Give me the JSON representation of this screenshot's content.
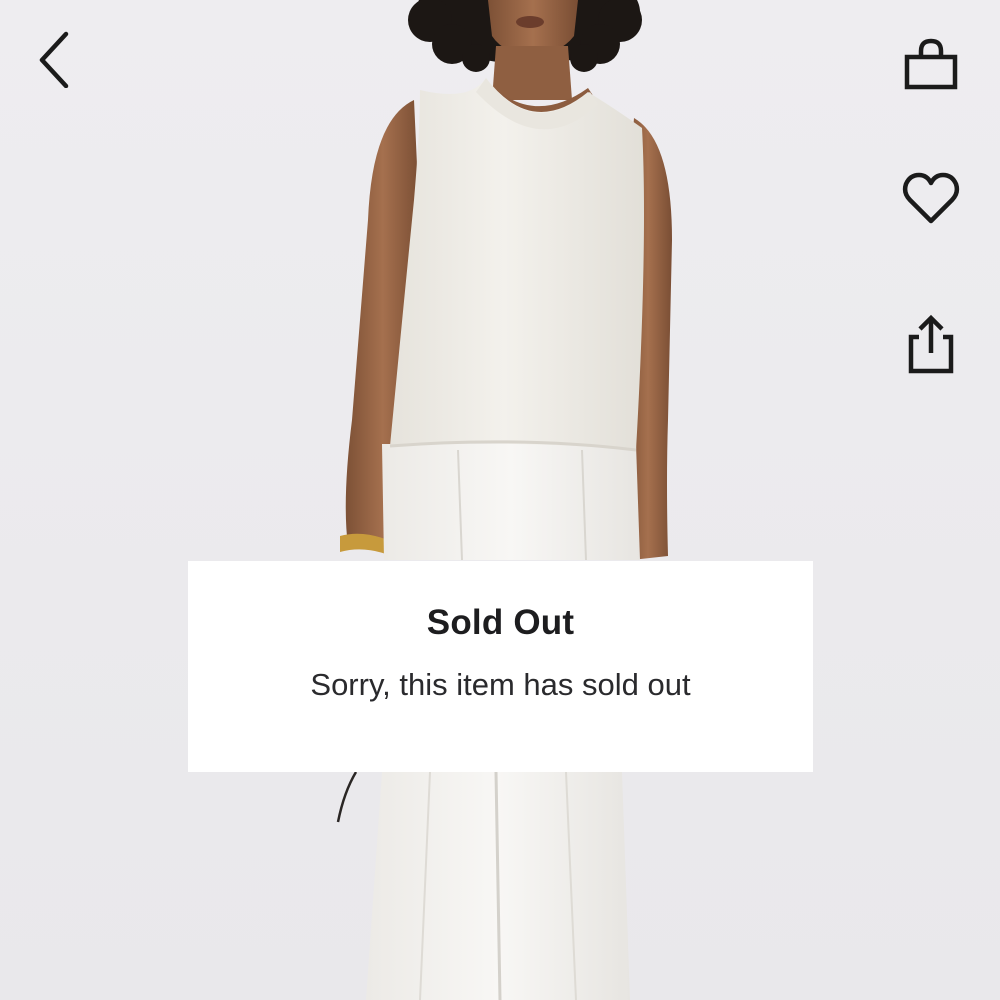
{
  "navigation": {
    "back_icon": "chevron-left-icon"
  },
  "actions": {
    "items": [
      {
        "icon": "shopping-bag-icon"
      },
      {
        "icon": "heart-icon"
      },
      {
        "icon": "share-icon"
      }
    ]
  },
  "product_image": {
    "description_colors": {
      "background": "#ecebee",
      "garment": "#f1efe9",
      "skin": "#9a6a4a"
    }
  },
  "status_dialog": {
    "title": "Sold Out",
    "message": "Sorry, this item has sold out"
  }
}
